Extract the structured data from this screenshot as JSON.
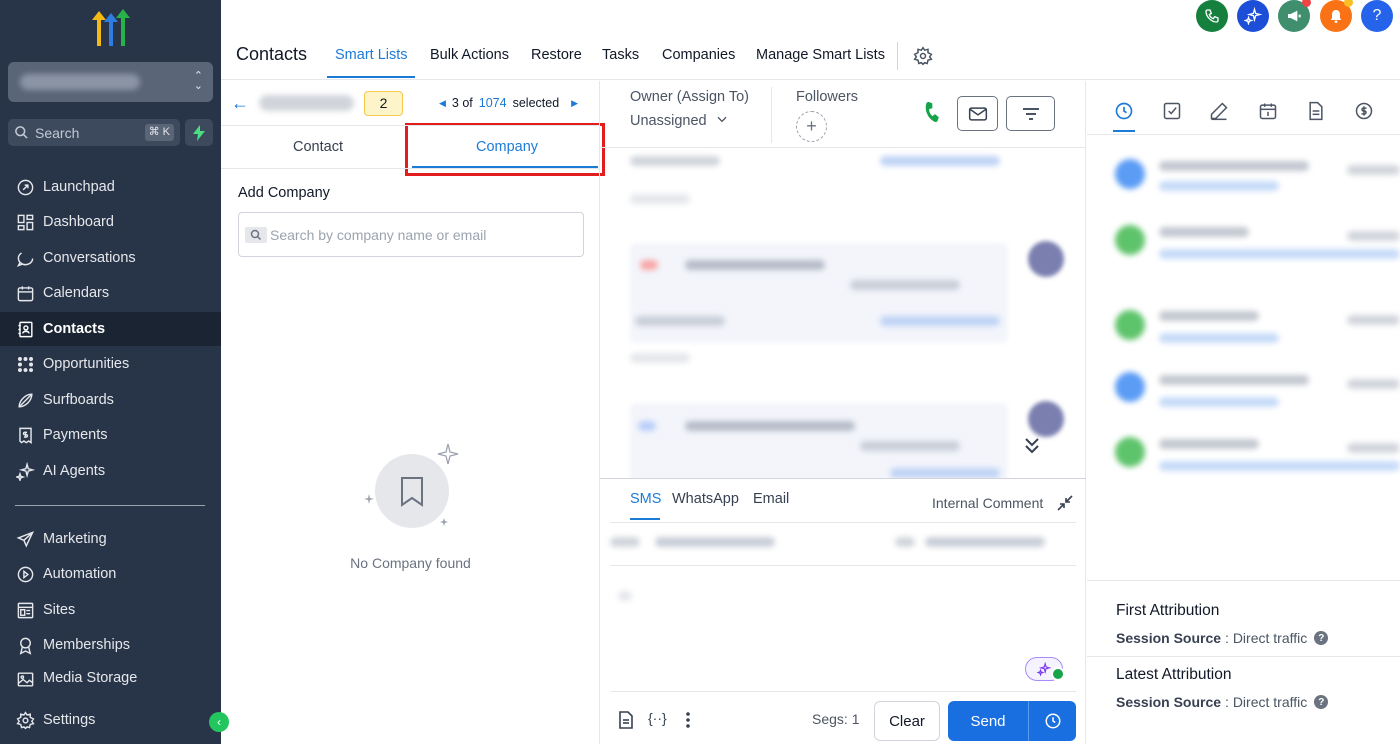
{
  "sidebar": {
    "search_placeholder": "Search",
    "search_shortcut": "⌘ K",
    "nav_items": [
      {
        "label": "Launchpad",
        "icon": "launchpad-icon"
      },
      {
        "label": "Dashboard",
        "icon": "dashboard-icon"
      },
      {
        "label": "Conversations",
        "icon": "chat-icon"
      },
      {
        "label": "Calendars",
        "icon": "calendar-icon"
      },
      {
        "label": "Contacts",
        "icon": "contacts-icon",
        "active": true
      },
      {
        "label": "Opportunities",
        "icon": "opportunities-icon"
      },
      {
        "label": "Surfboards",
        "icon": "surfboard-icon"
      },
      {
        "label": "Payments",
        "icon": "payments-icon"
      },
      {
        "label": "AI Agents",
        "icon": "sparkle-icon"
      },
      {
        "label": "Marketing",
        "icon": "send-icon"
      },
      {
        "label": "Automation",
        "icon": "automation-icon"
      },
      {
        "label": "Sites",
        "icon": "sites-icon"
      },
      {
        "label": "Memberships",
        "icon": "membership-icon"
      },
      {
        "label": "Media Storage",
        "icon": "media-icon"
      },
      {
        "label": "Settings",
        "icon": "gear-icon"
      }
    ]
  },
  "header": {
    "title": "Contacts",
    "tabs": [
      {
        "label": "Smart Lists",
        "active": true
      },
      {
        "label": "Bulk Actions"
      },
      {
        "label": "Restore"
      },
      {
        "label": "Tasks"
      },
      {
        "label": "Companies"
      },
      {
        "label": "Manage Smart Lists"
      }
    ]
  },
  "left_panel": {
    "count_badge": "2",
    "pager": {
      "current": "3 of",
      "total": "1074",
      "suffix": "selected"
    },
    "tabs": {
      "contact": "Contact",
      "company": "Company"
    },
    "add_company_label": "Add Company",
    "company_search_placeholder": "Search by company name or email",
    "empty_text": "No Company found"
  },
  "middle_panel": {
    "owner_label": "Owner (Assign To)",
    "owner_value": "Unassigned",
    "followers_label": "Followers",
    "composer": {
      "channels": {
        "sms": "SMS",
        "whatsapp": "WhatsApp",
        "email": "Email"
      },
      "internal_comment": "Internal Comment",
      "segs": "Segs: 1",
      "clear": "Clear",
      "send": "Send"
    }
  },
  "right_panel": {
    "first_attribution": {
      "title": "First Attribution",
      "label": "Session Source",
      "value": ": Direct traffic"
    },
    "latest_attribution": {
      "title": "Latest Attribution",
      "label": "Session Source",
      "value": ": Direct traffic"
    }
  },
  "colors": {
    "sidebar_bg": "#283548",
    "accent_blue": "#1d7bd8",
    "send_blue": "#1a6fe0",
    "highlight_red": "#e11d1d"
  }
}
